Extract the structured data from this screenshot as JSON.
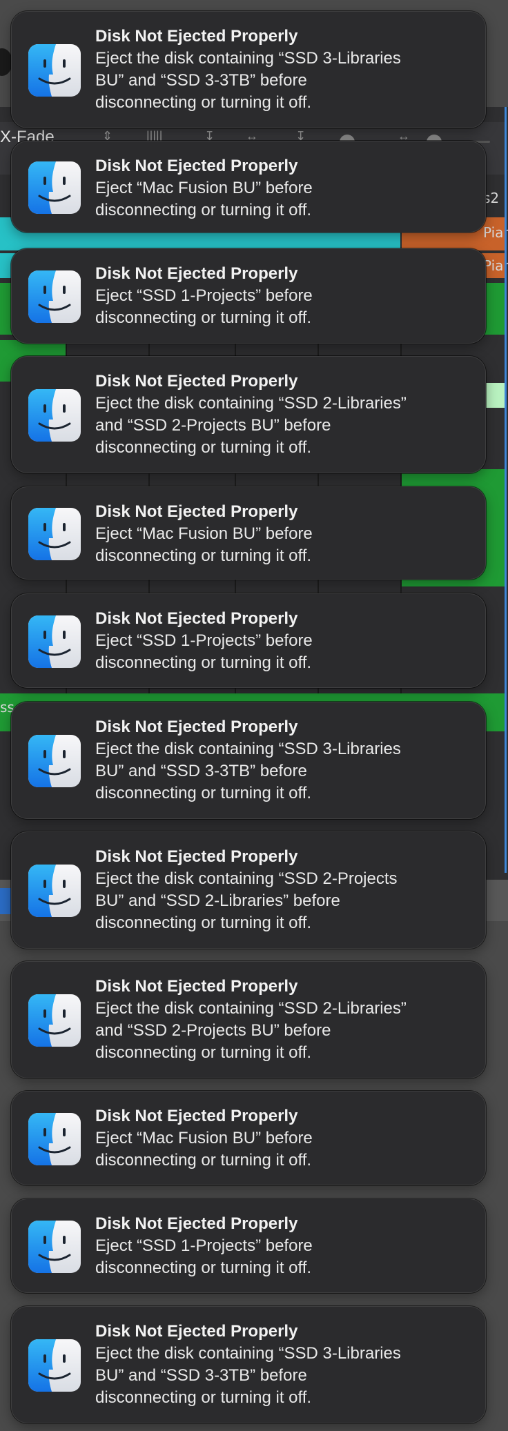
{
  "background_app": {
    "toolbar_label": "X-Fade",
    "region_labels": [
      "s2",
      "Pian",
      "Pian",
      "ss"
    ],
    "colors": {
      "cyan_region": "#27c1c6",
      "orange_region": "#c8622a",
      "green_region": "#1f9a34",
      "light_green_region": "#b9f2c0",
      "window_selection": "#3d86d8"
    }
  },
  "notifications": [
    {
      "icon": "finder-icon",
      "title": "Disk Not Ejected Properly",
      "lines": [
        "Eject the disk containing “SSD 3-Libraries",
        "BU” and “SSD 3-3TB” before",
        "disconnecting or turning it off."
      ]
    },
    {
      "icon": "finder-icon",
      "title": "Disk Not Ejected Properly",
      "lines": [
        "Eject “Mac Fusion BU” before",
        "disconnecting or turning it off."
      ]
    },
    {
      "icon": "finder-icon",
      "title": "Disk Not Ejected Properly",
      "lines": [
        "Eject “SSD 1-Projects” before",
        "disconnecting or turning it off."
      ]
    },
    {
      "icon": "finder-icon",
      "title": "Disk Not Ejected Properly",
      "lines": [
        "Eject the disk containing “SSD 2-Libraries”",
        "and “SSD 2-Projects BU” before",
        "disconnecting or turning it off."
      ]
    },
    {
      "icon": "finder-icon",
      "title": "Disk Not Ejected Properly",
      "lines": [
        "Eject “Mac Fusion BU” before",
        "disconnecting or turning it off."
      ]
    },
    {
      "icon": "finder-icon",
      "title": "Disk Not Ejected Properly",
      "lines": [
        "Eject “SSD 1-Projects” before",
        "disconnecting or turning it off."
      ]
    },
    {
      "icon": "finder-icon",
      "title": "Disk Not Ejected Properly",
      "lines": [
        "Eject the disk containing “SSD 3-Libraries",
        "BU” and “SSD 3-3TB” before",
        "disconnecting or turning it off."
      ]
    },
    {
      "icon": "finder-icon",
      "title": "Disk Not Ejected Properly",
      "lines": [
        "Eject the disk containing “SSD 2-Projects",
        "BU” and “SSD 2-Libraries” before",
        "disconnecting or turning it off."
      ]
    },
    {
      "icon": "finder-icon",
      "title": "Disk Not Ejected Properly",
      "lines": [
        "Eject the disk containing “SSD 2-Libraries”",
        "and “SSD 2-Projects BU” before",
        "disconnecting or turning it off."
      ]
    },
    {
      "icon": "finder-icon",
      "title": "Disk Not Ejected Properly",
      "lines": [
        "Eject “Mac Fusion BU” before",
        "disconnecting or turning it off."
      ]
    },
    {
      "icon": "finder-icon",
      "title": "Disk Not Ejected Properly",
      "lines": [
        "Eject “SSD 1-Projects” before",
        "disconnecting or turning it off."
      ]
    },
    {
      "icon": "finder-icon",
      "title": "Disk Not Ejected Properly",
      "lines": [
        "Eject the disk containing “SSD 3-Libraries",
        "BU” and “SSD 3-3TB” before",
        "disconnecting or turning it off."
      ]
    }
  ]
}
